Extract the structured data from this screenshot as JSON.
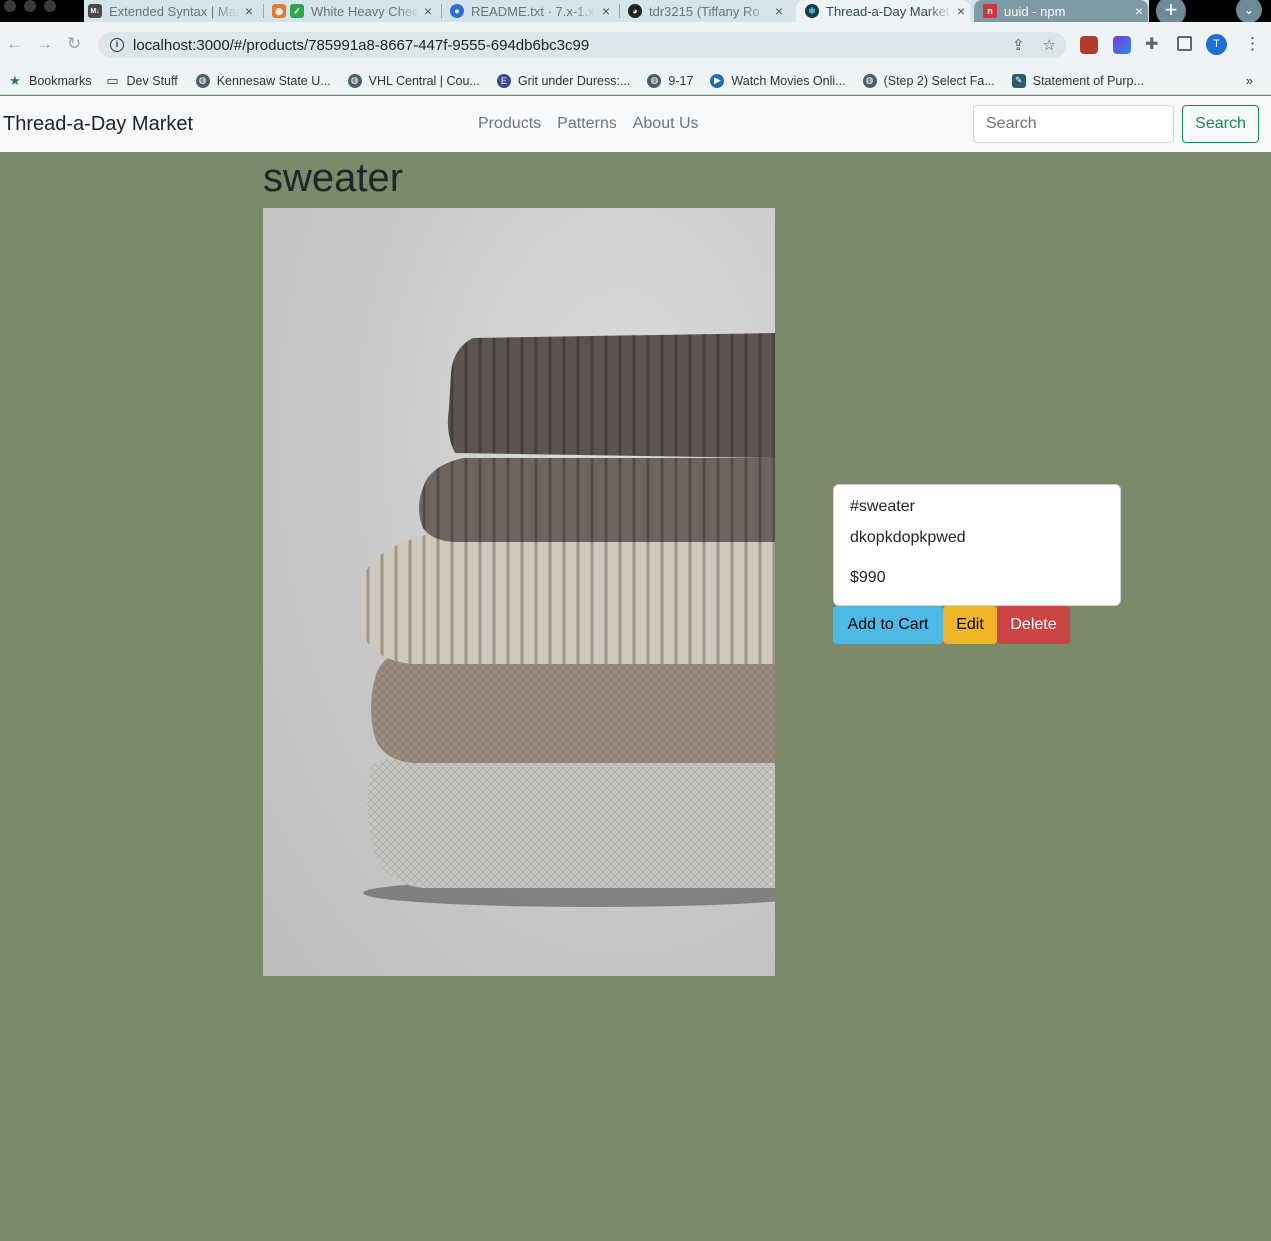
{
  "browser": {
    "tabs": [
      {
        "title": "Extended Syntax | Markdown Guide",
        "favicon": "md-icon",
        "color": "#4a4a4a"
      },
      {
        "title": "White Heavy Check Mark",
        "favicon": "check-mark-icon",
        "color": "#2ea44f"
      },
      {
        "title": "README.txt · 7.x-1.x",
        "favicon": "drupal-icon",
        "color": "#2a6fd6"
      },
      {
        "title": "tdr3215 (Tiffany Ro",
        "favicon": "github-icon",
        "color": "#222222"
      },
      {
        "title": "Thread-a-Day Market",
        "favicon": "react-icon",
        "color": "#1c3a4a",
        "active": true
      },
      {
        "title": "uuid - npm",
        "favicon": "npm-icon",
        "color": "#cb3837"
      }
    ],
    "url": "localhost:3000/#/products/785991a8-8667-447f-9555-694db6bc3c99",
    "profile_initial": "T",
    "bookmarks": [
      {
        "label": "Bookmarks",
        "icon": "star-icon"
      },
      {
        "label": "Dev Stuff",
        "icon": "folder-icon"
      },
      {
        "label": "Kennesaw State U...",
        "icon": "globe-icon"
      },
      {
        "label": "VHL Central | Cou...",
        "icon": "globe-icon"
      },
      {
        "label": "Grit under Duress:...",
        "icon": "book-icon"
      },
      {
        "label": "9-17",
        "icon": "globe-icon"
      },
      {
        "label": "Watch Movies Onli...",
        "icon": "play-icon"
      },
      {
        "label": "(Step 2) Select Fa...",
        "icon": "globe-icon"
      },
      {
        "label": "Statement of Purp...",
        "icon": "pen-icon"
      }
    ]
  },
  "navbar": {
    "brand": "Thread-a-Day Market",
    "links": [
      "Products",
      "Patterns",
      "About Us"
    ],
    "search_placeholder": "Search",
    "search_button": "Search"
  },
  "product": {
    "name": "sweater",
    "image_subject": "stack of folded knit sweaters",
    "tag": "#sweater",
    "description": "dkopkdopkpwed",
    "price": "$990"
  },
  "actions": {
    "add_to_cart": "Add to Cart",
    "edit": "Edit",
    "delete": "Delete"
  },
  "colors": {
    "page_background": "#7a8a6b",
    "add_to_cart": "#4cb9e6",
    "edit": "#f0b428",
    "delete": "#cb4444",
    "search_outline": "#198754"
  }
}
